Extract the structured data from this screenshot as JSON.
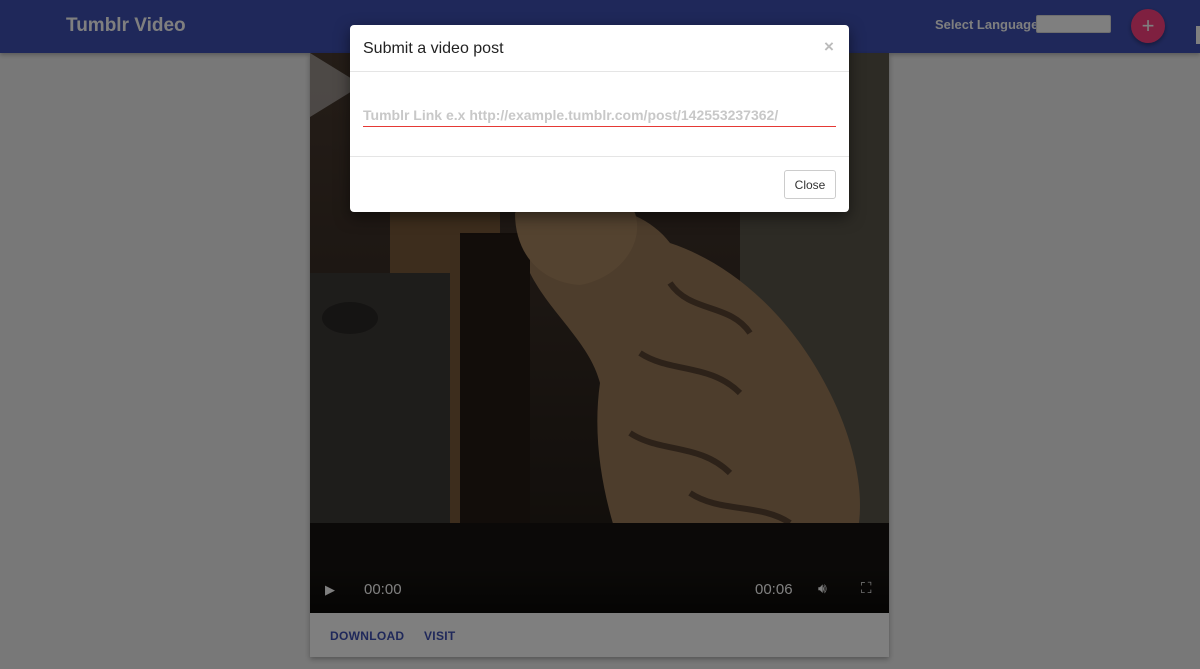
{
  "app": {
    "title": "Tumblr Video"
  },
  "header": {
    "language_label": "Select Language:",
    "language_value": "",
    "add_icon": "plus-icon",
    "add_symbol": "+"
  },
  "video": {
    "current_time": "00:00",
    "duration": "00:06",
    "play_icon": "play-icon",
    "volume_icon": "volume-icon",
    "fullscreen_icon": "fullscreen-icon",
    "big_play_icon": "big-play-icon"
  },
  "card_actions": {
    "download": "DOWNLOAD",
    "visit": "VISIT"
  },
  "modal": {
    "title": "Submit a video post",
    "close_x": "×",
    "input_placeholder": "Tumblr Link e.x http://example.tumblr.com/post/142553237362/",
    "input_value": "",
    "close_button": "Close"
  },
  "colors": {
    "primary": "#3f51b5",
    "accent": "#ff4081",
    "input_underline": "#e53935"
  }
}
